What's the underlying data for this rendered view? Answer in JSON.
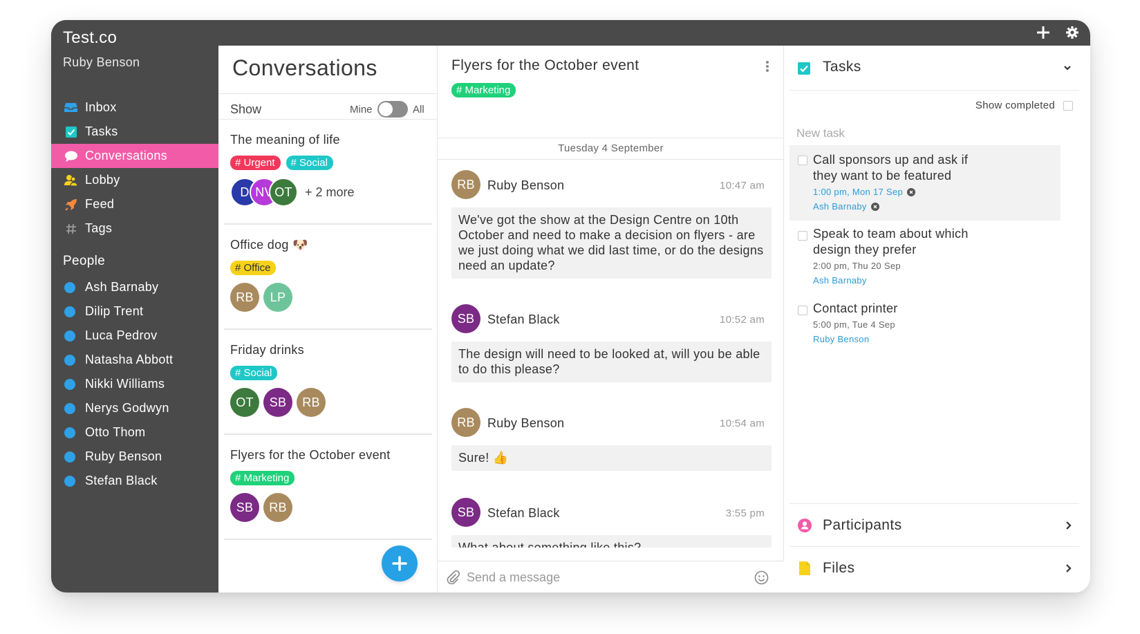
{
  "app": {
    "org_name": "Test.co",
    "user_name": "Ruby Benson"
  },
  "sidebar": {
    "nav": [
      {
        "label": "Inbox",
        "icon": "inbox-icon",
        "color": "#2fa1e8"
      },
      {
        "label": "Tasks",
        "icon": "checkbox-icon",
        "color": "#1fc7c7"
      },
      {
        "label": "Conversations",
        "icon": "chat-bubble-icon",
        "color": "#ffffff",
        "active": true
      },
      {
        "label": "Lobby",
        "icon": "people-icon",
        "color": "#f7d21c"
      },
      {
        "label": "Feed",
        "icon": "rocket-icon",
        "color": "#f7893b"
      },
      {
        "label": "Tags",
        "icon": "hash-icon",
        "color": "#9b9b9b"
      }
    ],
    "people_title": "People",
    "people": [
      "Ash Barnaby",
      "Dilip Trent",
      "Luca Pedrov",
      "Natasha Abbott",
      "Nikki Williams",
      "Nerys Godwyn",
      "Otto Thom",
      "Ruby Benson",
      "Stefan Black"
    ]
  },
  "conversations": {
    "title": "Conversations",
    "show_label": "Show",
    "toggle_left": "Mine",
    "toggle_right": "All",
    "items": [
      {
        "name": "The meaning of life",
        "tags": [
          {
            "label": "# Urgent",
            "color": "#f2385a"
          },
          {
            "label": "# Social",
            "color": "#1fc7c7"
          }
        ],
        "avatars": [
          {
            "initials": "D",
            "color": "#2a3aa8"
          },
          {
            "initials": "NV",
            "color": "#b53ad9"
          },
          {
            "initials": "OT",
            "color": "#3d7a3d"
          }
        ],
        "more": "+ 2 more"
      },
      {
        "name": "Office dog 🐶",
        "tags": [
          {
            "label": "# Office",
            "color": "#f7d21c"
          }
        ],
        "avatars": [
          {
            "initials": "RB",
            "color": "#a88a5e"
          },
          {
            "initials": "LP",
            "color": "#6ec49a"
          }
        ],
        "more": ""
      },
      {
        "name": "Friday drinks",
        "tags": [
          {
            "label": "# Social",
            "color": "#1fc7c7"
          }
        ],
        "avatars": [
          {
            "initials": "OT",
            "color": "#3d7a3d"
          },
          {
            "initials": "SB",
            "color": "#7b2a85"
          },
          {
            "initials": "RB",
            "color": "#a88a5e"
          }
        ],
        "more": ""
      },
      {
        "name": "Flyers for the October event",
        "tags": [
          {
            "label": "# Marketing",
            "color": "#1fd17a"
          }
        ],
        "avatars": [
          {
            "initials": "SB",
            "color": "#7b2a85"
          },
          {
            "initials": "RB",
            "color": "#a88a5e"
          }
        ],
        "more": ""
      }
    ]
  },
  "thread": {
    "title": "Flyers for the October event",
    "tag": {
      "label": "# Marketing",
      "color": "#1fd17a"
    },
    "date": "Tuesday 4 September",
    "messages": [
      {
        "initials": "RB",
        "color": "#a88a5e",
        "author": "Ruby Benson",
        "time": "10:47 am",
        "text": "We've got the show at the Design Centre on 10th October and need to make a decision on flyers - are we just doing what we did last time, or do the designs need an update?"
      },
      {
        "initials": "SB",
        "color": "#7b2a85",
        "author": "Stefan Black",
        "time": "10:52 am",
        "text": "The design will need to be looked at, will you be able to do this please?"
      },
      {
        "initials": "RB",
        "color": "#a88a5e",
        "author": "Ruby Benson",
        "time": "10:54 am",
        "text": "Sure! 👍"
      },
      {
        "initials": "SB",
        "color": "#7b2a85",
        "author": "Stefan Black",
        "time": "3:55 pm",
        "text": "What about something like this?"
      }
    ],
    "composer_placeholder": "Send a message"
  },
  "tasks": {
    "title": "Tasks",
    "show_completed": "Show completed",
    "new_task_placeholder": "New task",
    "items": [
      {
        "title": "Call sponsors up and ask if they want to be featured",
        "due": "1:00 pm, Mon 17 Sep",
        "assignee": "Ash Barnaby"
      },
      {
        "title": "Speak to team about which design they prefer",
        "due": "2:00 pm, Thu 20 Sep",
        "assignee": "Ash Barnaby"
      },
      {
        "title": "Contact printer",
        "due": "5:00 pm, Tue 4 Sep",
        "assignee": "Ruby Benson"
      }
    ],
    "participants_label": "Participants",
    "files_label": "Files"
  },
  "colors": {
    "sidebar_bg": "#4a4a4b",
    "active_nav": "#f25ba7",
    "accent_blue": "#27a1e5",
    "teal": "#1fc7c7"
  }
}
